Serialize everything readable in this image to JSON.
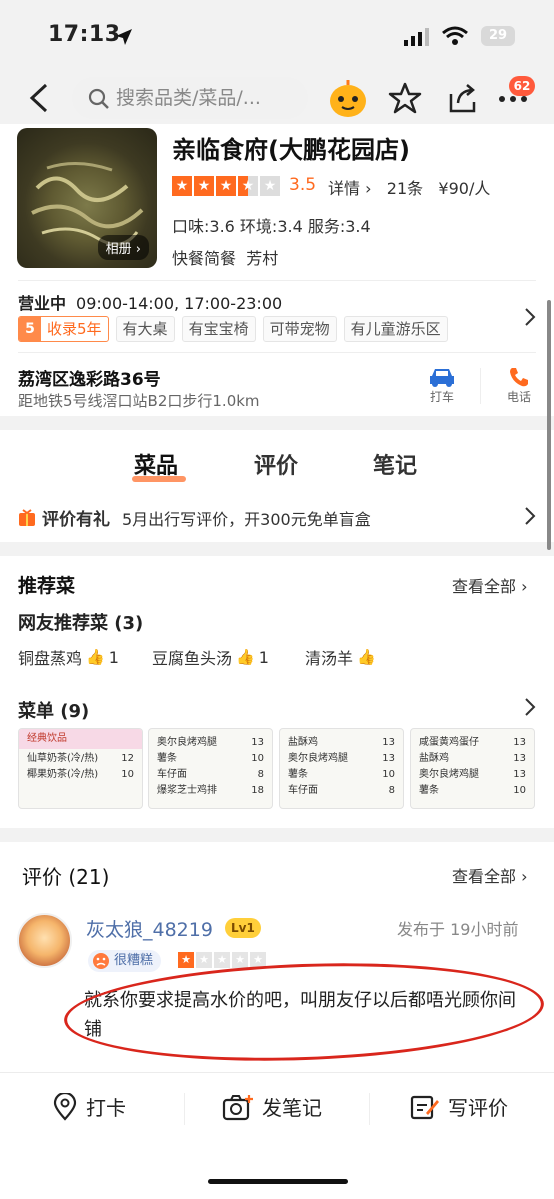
{
  "status": {
    "time": "17:13",
    "battery": "29"
  },
  "header": {
    "search_placeholder": "搜索品类/菜品/...",
    "notification_count": "62"
  },
  "shop": {
    "album_label": "相册",
    "name": "亲临食府(大鹏花园店)",
    "rating": "3.5",
    "rating_fraction": 0.7,
    "detail_text": "详情",
    "review_count": "21条",
    "price": "¥90/人",
    "sub_scores": "口味:3.6  环境:3.4  服务:3.4",
    "category": "快餐简餐",
    "area": "芳村",
    "hours_label": "营业中",
    "hours": "09:00-14:00, 17:00-23:00",
    "years_num": "5",
    "years_text": "收录5年",
    "tags": [
      "有大桌",
      "有宝宝椅",
      "可带宠物",
      "有儿童游乐区"
    ],
    "address": "荔湾区逸彩路36号",
    "metro": "距地铁5号线滘口站B2口步行1.0km",
    "taxi_label": "打车",
    "phone_label": "电话"
  },
  "tabs": [
    "菜品",
    "评价",
    "笔记"
  ],
  "promo": {
    "title": "评价有礼",
    "text": "5月出行写评价，开300元免单盲盒"
  },
  "recommend": {
    "title": "推荐菜",
    "see_all": "查看全部",
    "subtitle": "网友推荐菜 (3)",
    "dishes": [
      {
        "name": "铜盘蒸鸡",
        "likes": "1"
      },
      {
        "name": "豆腐鱼头汤",
        "likes": "1"
      },
      {
        "name": "清汤羊",
        "likes": ""
      }
    ],
    "menu_title": "菜单 (9)",
    "menu_cards": [
      {
        "rows": [
          [
            "经典饮品",
            ""
          ],
          [
            "",
            ""
          ],
          [
            "仙草奶茶(冷/热)",
            "12"
          ],
          [
            "椰果奶茶(冷/热)",
            "10"
          ]
        ]
      },
      {
        "rows": [
          [
            "奥尔良烤鸡腿",
            "13"
          ],
          [
            "薯条",
            "10"
          ],
          [
            "车仔面",
            "8"
          ],
          [
            "爆浆芝士鸡排",
            "18"
          ]
        ]
      },
      {
        "rows": [
          [
            "盐酥鸡",
            "13"
          ],
          [
            "奥尔良烤鸡腿",
            "13"
          ],
          [
            "薯条",
            "10"
          ],
          [
            "车仔面",
            "8"
          ]
        ]
      },
      {
        "rows": [
          [
            "咸蛋黄鸡蛋仔",
            "13"
          ],
          [
            "盐酥鸡",
            "13"
          ],
          [
            "奥尔良烤鸡腿",
            "13"
          ],
          [
            "薯条",
            "10"
          ]
        ]
      }
    ]
  },
  "reviews": {
    "title": "评价 (21)",
    "see_all": "查看全部",
    "items": [
      {
        "username": "灰太狼_48219",
        "level": "Lv1",
        "time": "发布于 19小时前",
        "rating_tag": "很糟糕",
        "stars": 1,
        "text": "就系你要求提高水价的吧，叫朋友仔以后都唔光顾你间铺"
      }
    ]
  },
  "bottom_bar": {
    "checkin": "打卡",
    "note": "发笔记",
    "review": "写评价"
  },
  "colors": {
    "accent": "#ff6a1f",
    "link_blue": "#4f6fa8",
    "annotation_red": "#d9261c"
  }
}
